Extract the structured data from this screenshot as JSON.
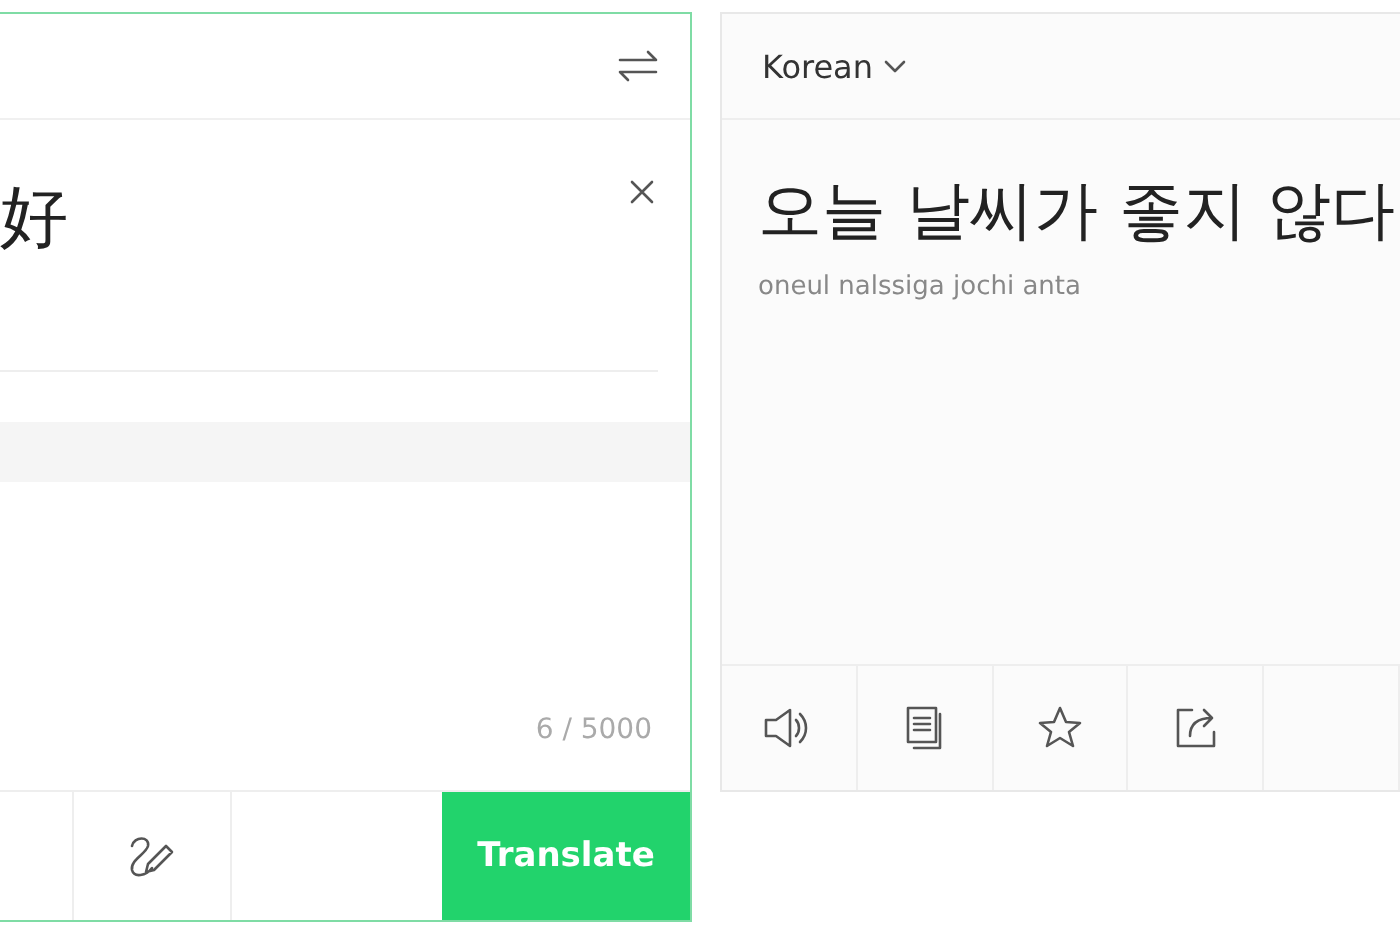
{
  "source": {
    "text": "好",
    "char_count": "6 / 5000",
    "translate_button": "Translate"
  },
  "target": {
    "language": "Korean",
    "text": "오늘 날씨가 좋지 않다",
    "romanization": "oneul nalssiga jochi anta"
  }
}
